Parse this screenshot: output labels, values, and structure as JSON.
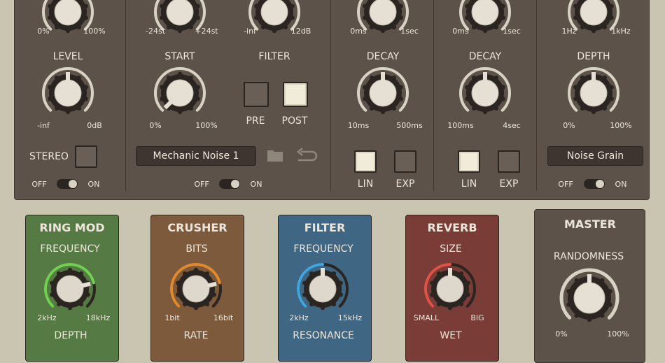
{
  "colors": {
    "background": "#cac5b1",
    "panel": "#5d5249",
    "ring_mod": "#567a44",
    "crusher": "#7d5a3c",
    "filter": "#3f6682",
    "reverb": "#7a3c36",
    "master": "#5d5249",
    "ring_mod_accent": "#6fd14f",
    "crusher_accent": "#e08a2c",
    "filter_accent": "#3fa6e0",
    "reverb_accent": "#e05245"
  },
  "col1": {
    "top_knob": {
      "min": "0%",
      "max": "100%"
    },
    "level": {
      "label": "LEVEL",
      "min": "-inf",
      "max": "0dB"
    },
    "stereo": {
      "label": "STEREO"
    },
    "toggle": {
      "off": "OFF",
      "on": "ON"
    }
  },
  "col2": {
    "top_knob_a": {
      "min": "-24st",
      "max": "+24st"
    },
    "top_knob_b": {
      "min": "-inf",
      "max": "12dB"
    },
    "start": {
      "label": "START",
      "min": "0%",
      "max": "100%"
    },
    "filter": {
      "label": "FILTER",
      "pre": "PRE",
      "post": "POST",
      "selected": "POST"
    },
    "sample_name": "Mechanic Noise 1",
    "toggle": {
      "off": "OFF",
      "on": "ON"
    }
  },
  "col3": {
    "top_knob": {
      "min": "0ms",
      "max": "1sec"
    },
    "decay": {
      "label": "DECAY",
      "min": "10ms",
      "max": "500ms"
    },
    "curve": {
      "lin": "LIN",
      "exp": "EXP",
      "selected": "LIN"
    }
  },
  "col4": {
    "top_knob": {
      "min": "0ms",
      "max": "1sec"
    },
    "decay": {
      "label": "DECAY",
      "min": "100ms",
      "max": "4sec"
    },
    "curve": {
      "lin": "LIN",
      "exp": "EXP",
      "selected": "LIN"
    }
  },
  "col5": {
    "top_knob": {
      "min": "1Hz",
      "max": "1kHz"
    },
    "depth": {
      "label": "DEPTH",
      "min": "0%",
      "max": "100%"
    },
    "noise_type": "Noise Grain",
    "toggle": {
      "off": "OFF",
      "on": "ON"
    }
  },
  "ring_mod": {
    "title": "RING MOD",
    "frequency": "FREQUENCY",
    "min": "2kHz",
    "max": "18kHz",
    "next": "DEPTH"
  },
  "crusher": {
    "title": "CRUSHER",
    "bits": "BITS",
    "min": "1bit",
    "max": "16bit",
    "next": "RATE"
  },
  "filter_fx": {
    "title": "FILTER",
    "frequency": "FREQUENCY",
    "min": "2kHz",
    "max": "15kHz",
    "next": "RESONANCE"
  },
  "reverb": {
    "title": "REVERB",
    "size": "SIZE",
    "min": "SMALL",
    "max": "BIG",
    "next": "WET"
  },
  "master": {
    "title": "MASTER",
    "randomness": "RANDOMNESS",
    "min": "0%",
    "max": "100%"
  }
}
